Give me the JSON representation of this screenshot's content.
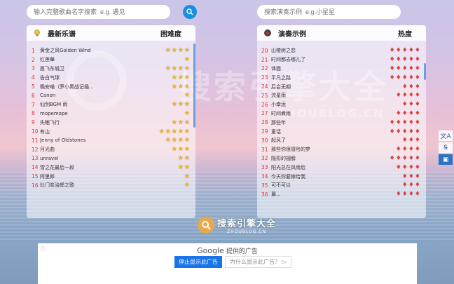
{
  "search_left": {
    "placeholder": "输入完整歌曲名字搜索  e.g. 遇见"
  },
  "search_right": {
    "placeholder": "搜索演奏示例  e.g.小星星"
  },
  "left_panel": {
    "title": "最新乐谱",
    "column": "困难度",
    "items": [
      {
        "num": "1",
        "name": "黄金之风Golden Wind",
        "stars": 4
      },
      {
        "num": "2",
        "name": "红莲華",
        "stars": 1
      },
      {
        "num": "3",
        "name": "愿飞东城卫",
        "stars": 4
      },
      {
        "num": "4",
        "name": "告白气球",
        "stars": 3
      },
      {
        "num": "5",
        "name": "晚安喵（罗小黑战记插...",
        "stars": 3
      },
      {
        "num": "6",
        "name": "Canon",
        "stars": 1
      },
      {
        "num": "7",
        "name": "仙剑BGM 雨",
        "stars": 3
      },
      {
        "num": "8",
        "name": "mopemope",
        "stars": 1
      },
      {
        "num": "9",
        "name": "失眠飞行",
        "stars": 3
      },
      {
        "num": "10",
        "name": "有山",
        "stars": 5
      },
      {
        "num": "11",
        "name": "Jenny of Oldstones",
        "stars": 4
      },
      {
        "num": "12",
        "name": "月光曲",
        "stars": 3
      },
      {
        "num": "13",
        "name": "unravel",
        "stars": 2
      },
      {
        "num": "14",
        "name": "雪之花最后一段",
        "stars": 2
      },
      {
        "num": "15",
        "name": "阿里郎",
        "stars": 1
      },
      {
        "num": "16",
        "name": "灶门炭治郎之歌",
        "stars": 1
      }
    ]
  },
  "right_panel": {
    "title": "演奏示例",
    "column": "热度",
    "items": [
      {
        "num": "20",
        "name": "山楂树之恋",
        "hearts": 5
      },
      {
        "num": "21",
        "name": "时间都去哪儿了",
        "hearts": 5
      },
      {
        "num": "22",
        "name": "体面",
        "hearts": 5
      },
      {
        "num": "23",
        "name": "平凡之路",
        "hearts": 5
      },
      {
        "num": "24",
        "name": "后会无期",
        "hearts": 3
      },
      {
        "num": "25",
        "name": "流星雨",
        "hearts": 4
      },
      {
        "num": "26",
        "name": "小幸运",
        "hearts": 3
      },
      {
        "num": "27",
        "name": "时间煮雨",
        "hearts": 4
      },
      {
        "num": "28",
        "name": "那些年",
        "hearts": 5
      },
      {
        "num": "29",
        "name": "童话",
        "hearts": 5
      },
      {
        "num": "30",
        "name": "起风了",
        "hearts": 3
      },
      {
        "num": "31",
        "name": "那些你很冒险的梦",
        "hearts": 4
      },
      {
        "num": "32",
        "name": "隐形的翅膀",
        "hearts": 5
      },
      {
        "num": "33",
        "name": "阳光总在风雨后",
        "hearts": 4
      },
      {
        "num": "34",
        "name": "今天你要嫁给我",
        "hearts": 3
      },
      {
        "num": "35",
        "name": "可不可以",
        "hearts": 3
      },
      {
        "num": "36",
        "name": "最...",
        "hearts": 4
      }
    ]
  },
  "side_tools": [
    {
      "icon": "translate-icon",
      "glyph": "文A"
    },
    {
      "icon": "strike-icon",
      "glyph": "S̶"
    },
    {
      "icon": "image-icon",
      "glyph": "▣"
    }
  ],
  "watermark": {
    "text": "搜索引擎大全",
    "sub": "ZHOUBLOG.CN",
    "big": "搜索引擎大全",
    "big_url": "ZHOUBLOG.CN"
  },
  "ad": {
    "info": "ⓘ",
    "provider": "Google",
    "provided": "提供的广告",
    "stop": "停止显示此广告",
    "why": "为什么显示此广告？ ▷"
  },
  "colors": {
    "accent": "#1a8fe0",
    "star": "#e8b83a",
    "heart": "#d84545"
  }
}
